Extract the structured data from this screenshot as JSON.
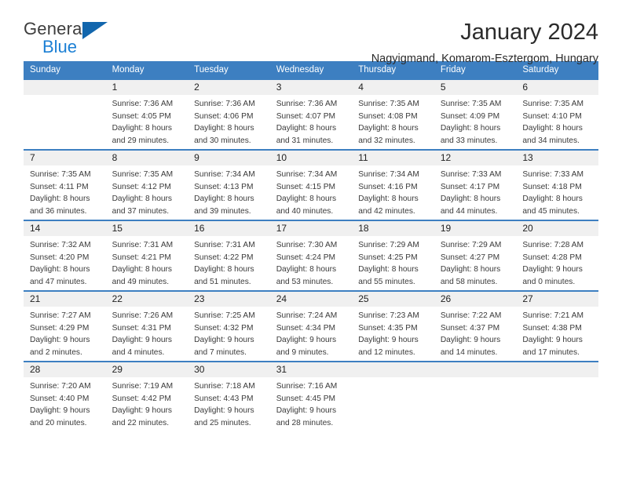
{
  "brand": {
    "name_top": "General",
    "name_bottom": "Blue",
    "accent_color": "#1b7fd4",
    "flag_color": "#1266ad"
  },
  "header": {
    "title": "January 2024",
    "subtitle": "Nagyigmand, Komarom-Esztergom, Hungary"
  },
  "calendar": {
    "header_bg": "#3d7fc1",
    "daynum_bg": "#f0f0f0",
    "weekdays": [
      "Sunday",
      "Monday",
      "Tuesday",
      "Wednesday",
      "Thursday",
      "Friday",
      "Saturday"
    ],
    "weeks": [
      [
        {
          "day": "",
          "empty": true,
          "sunrise": "",
          "sunset": "",
          "daylight1": "",
          "daylight2": ""
        },
        {
          "day": "1",
          "sunrise": "Sunrise: 7:36 AM",
          "sunset": "Sunset: 4:05 PM",
          "daylight1": "Daylight: 8 hours",
          "daylight2": "and 29 minutes."
        },
        {
          "day": "2",
          "sunrise": "Sunrise: 7:36 AM",
          "sunset": "Sunset: 4:06 PM",
          "daylight1": "Daylight: 8 hours",
          "daylight2": "and 30 minutes."
        },
        {
          "day": "3",
          "sunrise": "Sunrise: 7:36 AM",
          "sunset": "Sunset: 4:07 PM",
          "daylight1": "Daylight: 8 hours",
          "daylight2": "and 31 minutes."
        },
        {
          "day": "4",
          "sunrise": "Sunrise: 7:35 AM",
          "sunset": "Sunset: 4:08 PM",
          "daylight1": "Daylight: 8 hours",
          "daylight2": "and 32 minutes."
        },
        {
          "day": "5",
          "sunrise": "Sunrise: 7:35 AM",
          "sunset": "Sunset: 4:09 PM",
          "daylight1": "Daylight: 8 hours",
          "daylight2": "and 33 minutes."
        },
        {
          "day": "6",
          "sunrise": "Sunrise: 7:35 AM",
          "sunset": "Sunset: 4:10 PM",
          "daylight1": "Daylight: 8 hours",
          "daylight2": "and 34 minutes."
        }
      ],
      [
        {
          "day": "7",
          "sunrise": "Sunrise: 7:35 AM",
          "sunset": "Sunset: 4:11 PM",
          "daylight1": "Daylight: 8 hours",
          "daylight2": "and 36 minutes."
        },
        {
          "day": "8",
          "sunrise": "Sunrise: 7:35 AM",
          "sunset": "Sunset: 4:12 PM",
          "daylight1": "Daylight: 8 hours",
          "daylight2": "and 37 minutes."
        },
        {
          "day": "9",
          "sunrise": "Sunrise: 7:34 AM",
          "sunset": "Sunset: 4:13 PM",
          "daylight1": "Daylight: 8 hours",
          "daylight2": "and 39 minutes."
        },
        {
          "day": "10",
          "sunrise": "Sunrise: 7:34 AM",
          "sunset": "Sunset: 4:15 PM",
          "daylight1": "Daylight: 8 hours",
          "daylight2": "and 40 minutes."
        },
        {
          "day": "11",
          "sunrise": "Sunrise: 7:34 AM",
          "sunset": "Sunset: 4:16 PM",
          "daylight1": "Daylight: 8 hours",
          "daylight2": "and 42 minutes."
        },
        {
          "day": "12",
          "sunrise": "Sunrise: 7:33 AM",
          "sunset": "Sunset: 4:17 PM",
          "daylight1": "Daylight: 8 hours",
          "daylight2": "and 44 minutes."
        },
        {
          "day": "13",
          "sunrise": "Sunrise: 7:33 AM",
          "sunset": "Sunset: 4:18 PM",
          "daylight1": "Daylight: 8 hours",
          "daylight2": "and 45 minutes."
        }
      ],
      [
        {
          "day": "14",
          "sunrise": "Sunrise: 7:32 AM",
          "sunset": "Sunset: 4:20 PM",
          "daylight1": "Daylight: 8 hours",
          "daylight2": "and 47 minutes."
        },
        {
          "day": "15",
          "sunrise": "Sunrise: 7:31 AM",
          "sunset": "Sunset: 4:21 PM",
          "daylight1": "Daylight: 8 hours",
          "daylight2": "and 49 minutes."
        },
        {
          "day": "16",
          "sunrise": "Sunrise: 7:31 AM",
          "sunset": "Sunset: 4:22 PM",
          "daylight1": "Daylight: 8 hours",
          "daylight2": "and 51 minutes."
        },
        {
          "day": "17",
          "sunrise": "Sunrise: 7:30 AM",
          "sunset": "Sunset: 4:24 PM",
          "daylight1": "Daylight: 8 hours",
          "daylight2": "and 53 minutes."
        },
        {
          "day": "18",
          "sunrise": "Sunrise: 7:29 AM",
          "sunset": "Sunset: 4:25 PM",
          "daylight1": "Daylight: 8 hours",
          "daylight2": "and 55 minutes."
        },
        {
          "day": "19",
          "sunrise": "Sunrise: 7:29 AM",
          "sunset": "Sunset: 4:27 PM",
          "daylight1": "Daylight: 8 hours",
          "daylight2": "and 58 minutes."
        },
        {
          "day": "20",
          "sunrise": "Sunrise: 7:28 AM",
          "sunset": "Sunset: 4:28 PM",
          "daylight1": "Daylight: 9 hours",
          "daylight2": "and 0 minutes."
        }
      ],
      [
        {
          "day": "21",
          "sunrise": "Sunrise: 7:27 AM",
          "sunset": "Sunset: 4:29 PM",
          "daylight1": "Daylight: 9 hours",
          "daylight2": "and 2 minutes."
        },
        {
          "day": "22",
          "sunrise": "Sunrise: 7:26 AM",
          "sunset": "Sunset: 4:31 PM",
          "daylight1": "Daylight: 9 hours",
          "daylight2": "and 4 minutes."
        },
        {
          "day": "23",
          "sunrise": "Sunrise: 7:25 AM",
          "sunset": "Sunset: 4:32 PM",
          "daylight1": "Daylight: 9 hours",
          "daylight2": "and 7 minutes."
        },
        {
          "day": "24",
          "sunrise": "Sunrise: 7:24 AM",
          "sunset": "Sunset: 4:34 PM",
          "daylight1": "Daylight: 9 hours",
          "daylight2": "and 9 minutes."
        },
        {
          "day": "25",
          "sunrise": "Sunrise: 7:23 AM",
          "sunset": "Sunset: 4:35 PM",
          "daylight1": "Daylight: 9 hours",
          "daylight2": "and 12 minutes."
        },
        {
          "day": "26",
          "sunrise": "Sunrise: 7:22 AM",
          "sunset": "Sunset: 4:37 PM",
          "daylight1": "Daylight: 9 hours",
          "daylight2": "and 14 minutes."
        },
        {
          "day": "27",
          "sunrise": "Sunrise: 7:21 AM",
          "sunset": "Sunset: 4:38 PM",
          "daylight1": "Daylight: 9 hours",
          "daylight2": "and 17 minutes."
        }
      ],
      [
        {
          "day": "28",
          "sunrise": "Sunrise: 7:20 AM",
          "sunset": "Sunset: 4:40 PM",
          "daylight1": "Daylight: 9 hours",
          "daylight2": "and 20 minutes."
        },
        {
          "day": "29",
          "sunrise": "Sunrise: 7:19 AM",
          "sunset": "Sunset: 4:42 PM",
          "daylight1": "Daylight: 9 hours",
          "daylight2": "and 22 minutes."
        },
        {
          "day": "30",
          "sunrise": "Sunrise: 7:18 AM",
          "sunset": "Sunset: 4:43 PM",
          "daylight1": "Daylight: 9 hours",
          "daylight2": "and 25 minutes."
        },
        {
          "day": "31",
          "sunrise": "Sunrise: 7:16 AM",
          "sunset": "Sunset: 4:45 PM",
          "daylight1": "Daylight: 9 hours",
          "daylight2": "and 28 minutes."
        },
        {
          "day": "",
          "empty": true,
          "sunrise": "",
          "sunset": "",
          "daylight1": "",
          "daylight2": ""
        },
        {
          "day": "",
          "empty": true,
          "sunrise": "",
          "sunset": "",
          "daylight1": "",
          "daylight2": ""
        },
        {
          "day": "",
          "empty": true,
          "sunrise": "",
          "sunset": "",
          "daylight1": "",
          "daylight2": ""
        }
      ]
    ]
  }
}
